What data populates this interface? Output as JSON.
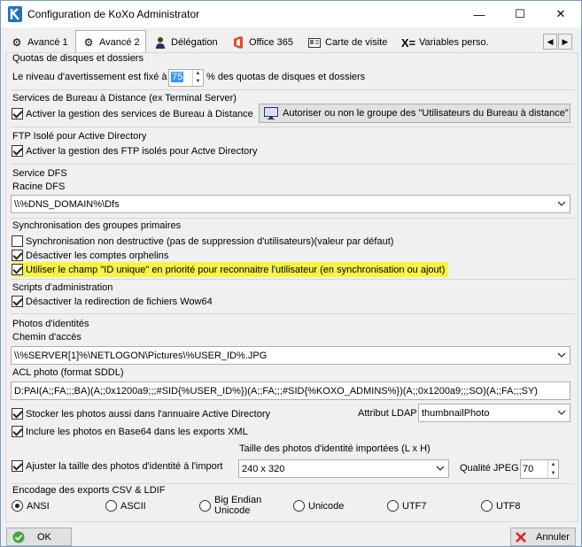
{
  "window": {
    "title": "Configuration de KoXo Administrator",
    "minimize": "—",
    "maximize": "☐",
    "close": "✕"
  },
  "tabs": [
    {
      "label": "Avancé 1",
      "icon": "gear-icon"
    },
    {
      "label": "Avancé 2",
      "icon": "gear-icon"
    },
    {
      "label": "Délégation",
      "icon": "person-icon"
    },
    {
      "label": "Office 365",
      "icon": "office-icon"
    },
    {
      "label": "Carte de visite",
      "icon": "card-icon"
    },
    {
      "label": "Variables perso.",
      "icon": "variable-icon"
    }
  ],
  "quotas": {
    "title": "Quotas de disques et dossiers",
    "prefix": "Le niveau d'avertissement est fixé à",
    "value": "75",
    "suffix": "% des quotas de disques et dossiers"
  },
  "rds": {
    "title": "Services de Bureau à Distance (ex Terminal Server)",
    "checkbox": "Activer la gestion des services de Bureau à Distance",
    "button": "Autoriser ou non le groupe des \"Utilisateurs du Bureau à distance\""
  },
  "ftp": {
    "title": "FTP Isolé pour Active Directory",
    "checkbox": "Activer la gestion des FTP isolés pour Actve Directory"
  },
  "dfs": {
    "title": "Service DFS",
    "label": "Racine DFS",
    "value": "\\\\%DNS_DOMAIN%\\Dfs"
  },
  "sync": {
    "title": "Synchronisation des groupes primaires",
    "cb1": "Synchronisation non destructive (pas de suppression d'utilisateurs)(valeur par défaut)",
    "cb2": "Désactiver les comptes orphelins",
    "cb3": "Utiliser le champ \"ID unique\" en priorité pour reconnaitre l'utilisateur (en synchronisation ou ajout)"
  },
  "scripts": {
    "title": "Scripts d'administration",
    "checkbox": "Désactiver la redirection de fichiers Wow64"
  },
  "photos": {
    "title": "Photos d'identités",
    "path_label": "Chemin d'accès",
    "path_value": "\\\\%SERVER[1]%\\NETLOGON\\Pictures\\%USER_ID%.JPG",
    "acl_label": "ACL photo (format SDDL)",
    "acl_value": "D:PAI(A;;FA;;;BA)(A;;0x1200a9;;;#SID{%USER_ID%})(A;;FA;;;#SID{%KOXO_ADMINS%})(A;;0x1200a9;;;SO)(A;;FA;;;SY)",
    "store_ad": "Stocker les photos aussi dans l'annuaire Active Directory",
    "ldap_label": "Attribut LDAP",
    "ldap_value": "thumbnailPhoto",
    "base64": "Inclure les photos en Base64 dans les exports XML",
    "size_label": "Taille des photos d'identité importées (L x H)",
    "resize": "Ajuster la taille des photos d'identité à l'import",
    "size_value": "240 x 320",
    "quality_label": "Qualité JPEG",
    "quality_value": "70"
  },
  "encoding": {
    "title": "Encodage des exports CSV & LDIF",
    "options": [
      "ANSI",
      "ASCII",
      "Big Endian\nUnicode",
      "Unicode",
      "UTF7",
      "UTF8"
    ],
    "selected": "ANSI"
  },
  "footer": {
    "ok": "OK",
    "cancel": "Annuler"
  }
}
